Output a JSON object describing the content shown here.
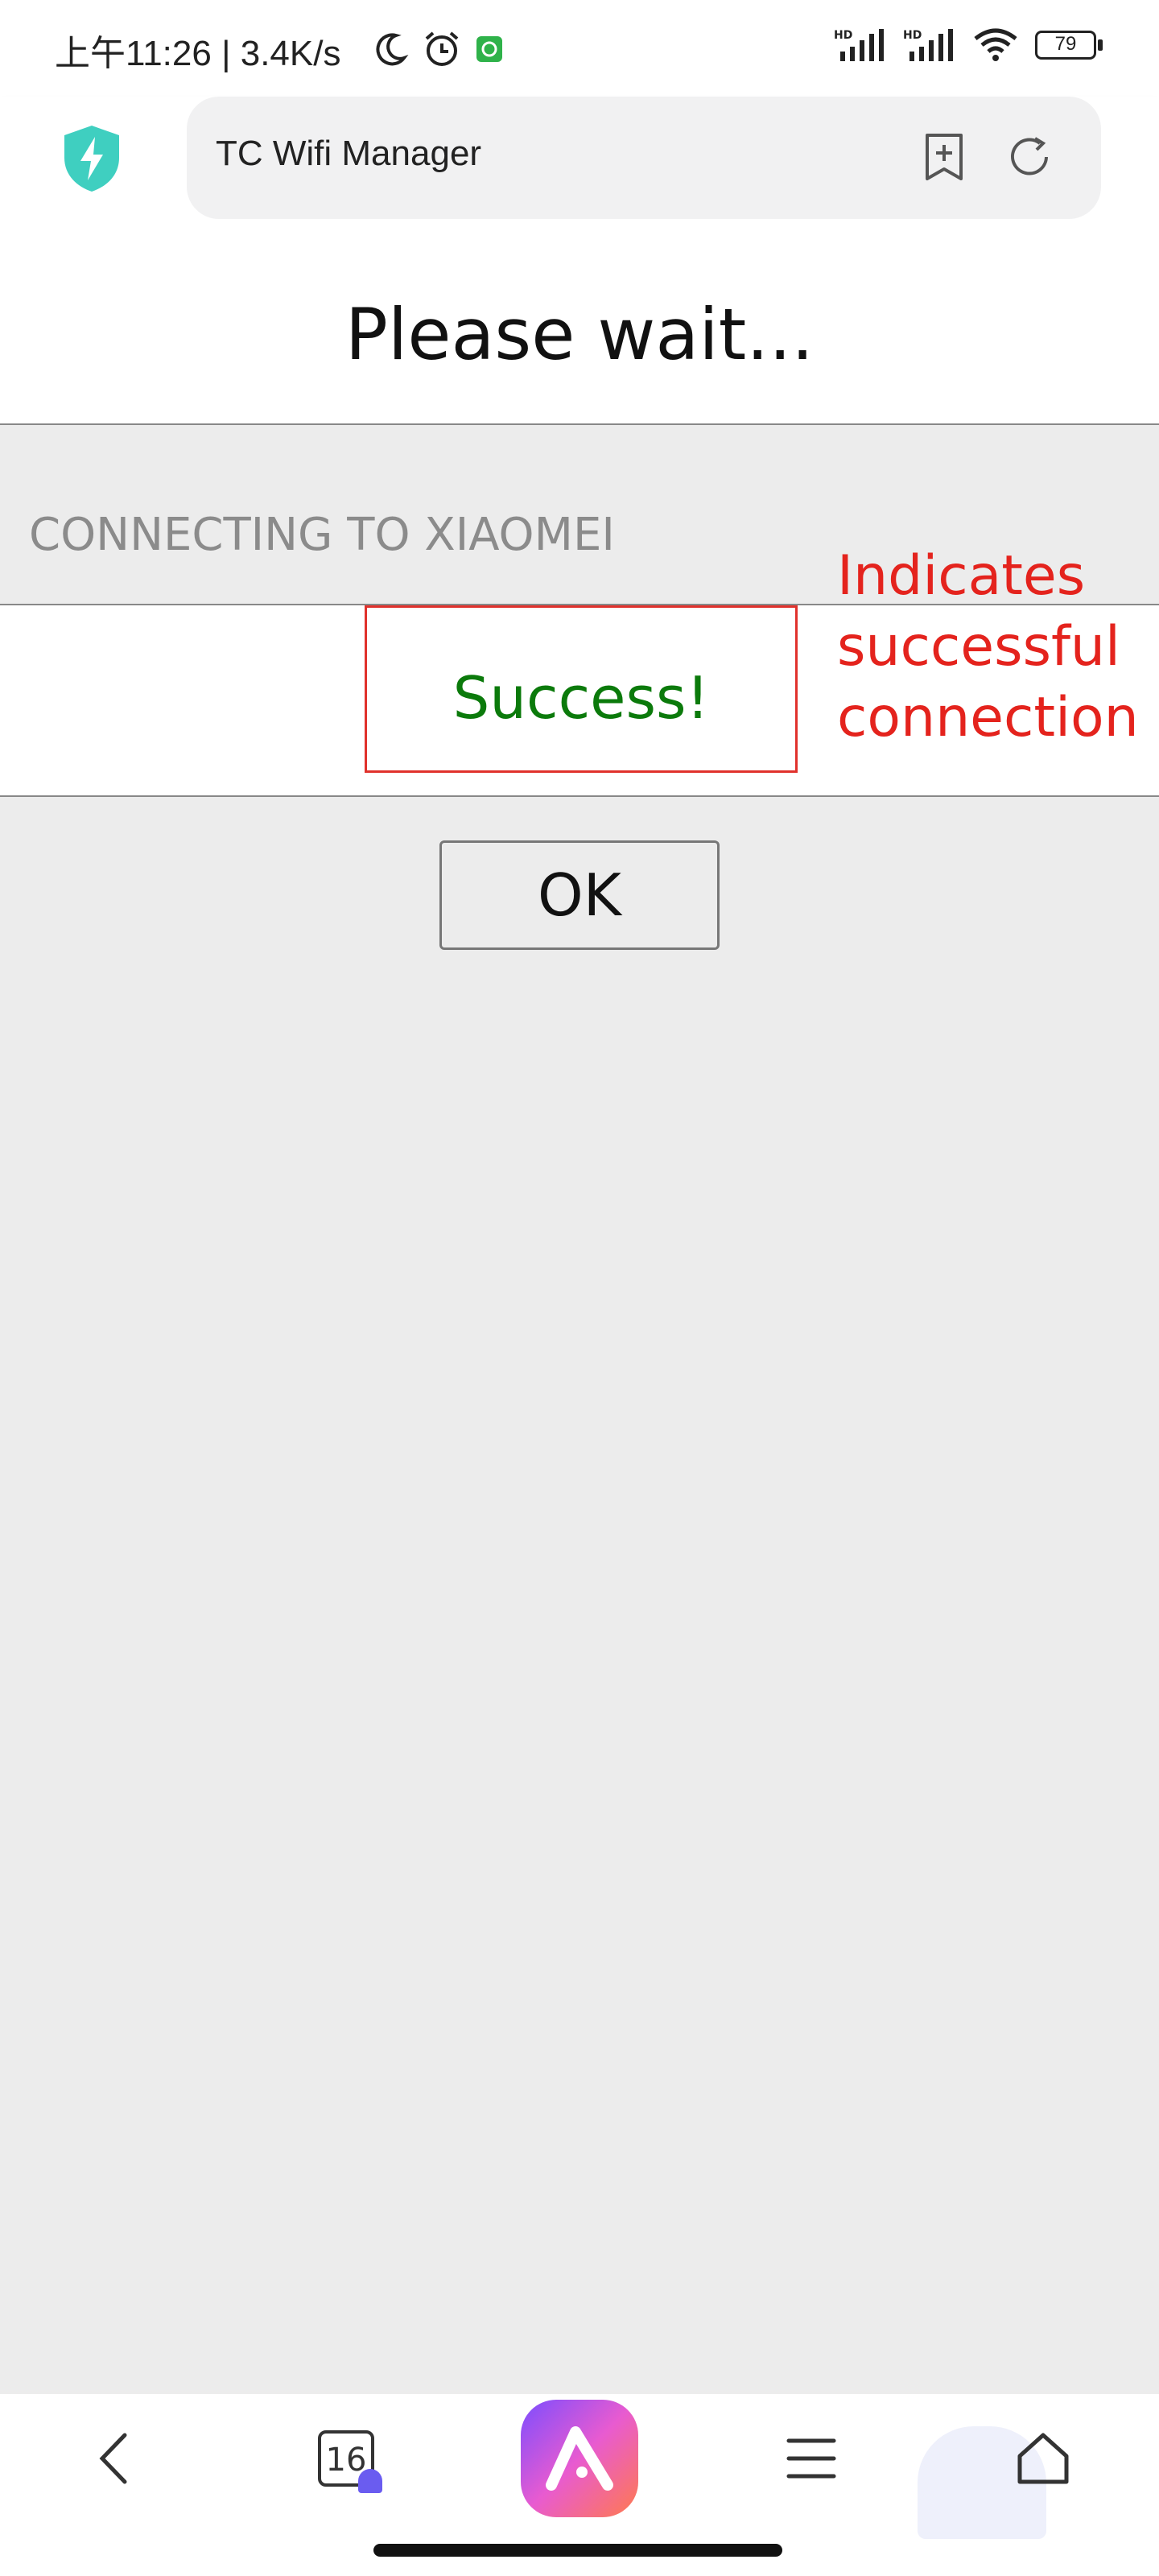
{
  "status_bar": {
    "time_text": "上午11:26 | 3.4K/s",
    "battery": "79",
    "icons": [
      "moon-icon",
      "alarm-icon",
      "app-notification-icon",
      "hd-signal-icon",
      "hd-signal-icon",
      "wifi-icon",
      "battery-icon"
    ]
  },
  "browser": {
    "url_title": "TC Wifi Manager",
    "icons": [
      "shield-lightning-icon",
      "bookmark-add-icon",
      "refresh-icon"
    ]
  },
  "page": {
    "title": "Please wait...",
    "connecting_text": "CONNECTING TO XIAOMEI",
    "success_text": "Success!",
    "ok_label": "OK"
  },
  "annotation": {
    "line1": "Indicates",
    "line2": "successful",
    "line3": "connection",
    "color": "#e4231d"
  },
  "bottom_nav": {
    "tab_count": "16",
    "icons": [
      "back-icon",
      "tabs-icon",
      "ai-assistant-icon",
      "menu-icon",
      "home-icon"
    ]
  },
  "colors": {
    "success_green": "#0b7a0b",
    "annotation_red": "#e4231d",
    "page_gray": "#ececec",
    "shield_teal": "#3fcfc0"
  }
}
